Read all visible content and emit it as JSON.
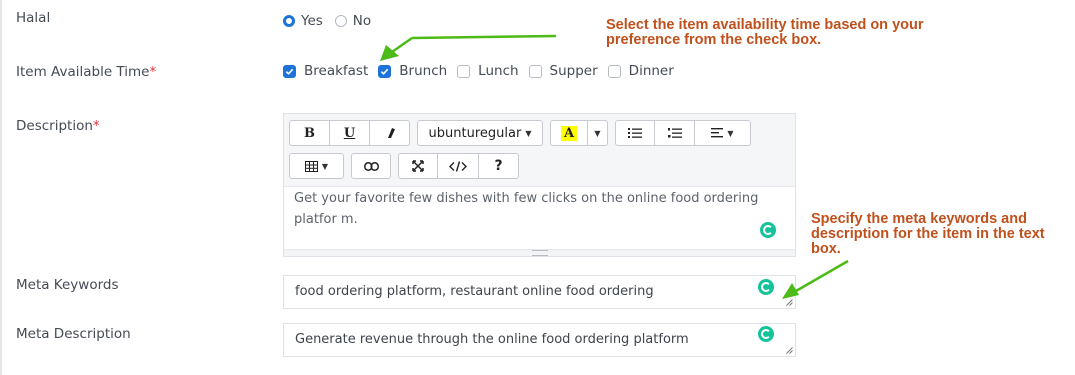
{
  "halal": {
    "label": "Halal",
    "options": [
      {
        "label": "Yes",
        "selected": true
      },
      {
        "label": "No",
        "selected": false
      }
    ]
  },
  "available_time": {
    "label": "Item Available Time",
    "required_mark": "*",
    "options": [
      {
        "label": "Breakfast",
        "checked": true
      },
      {
        "label": "Brunch",
        "checked": true
      },
      {
        "label": "Lunch",
        "checked": false
      },
      {
        "label": "Supper",
        "checked": false
      },
      {
        "label": "Dinner",
        "checked": false
      }
    ]
  },
  "description": {
    "label": "Description",
    "required_mark": "*",
    "toolbar": {
      "bold": "B",
      "underline": "U",
      "font_name": "ubunturegular",
      "text_color_glyph": "A",
      "help": "?"
    },
    "text": "Get your favorite few dishes with few clicks on the online food ordering platfor m."
  },
  "meta_keywords": {
    "label": "Meta Keywords",
    "value": "food ordering platform, restaurant online food ordering"
  },
  "meta_description": {
    "label": "Meta Description",
    "value": "Generate revenue through the online food ordering platform"
  },
  "annotations": {
    "availability_note": "Select the item availability time based on your preference from the check box.",
    "meta_note": "Specify the meta keywords and description for the item in the text box.",
    "color": "#c0501c",
    "arrow_color": "#4cbb17"
  },
  "icons": [
    "eraser-icon",
    "highlight-icon",
    "unordered-list-icon",
    "ordered-list-icon",
    "align-icon",
    "table-icon",
    "link-icon",
    "fullscreen-icon",
    "code-view-icon",
    "grammarly-icon"
  ],
  "colors": {
    "accent": "#1e73d8",
    "required": "#e0333a",
    "grammarly": "#15c39a",
    "highlight": "#ffff00"
  }
}
